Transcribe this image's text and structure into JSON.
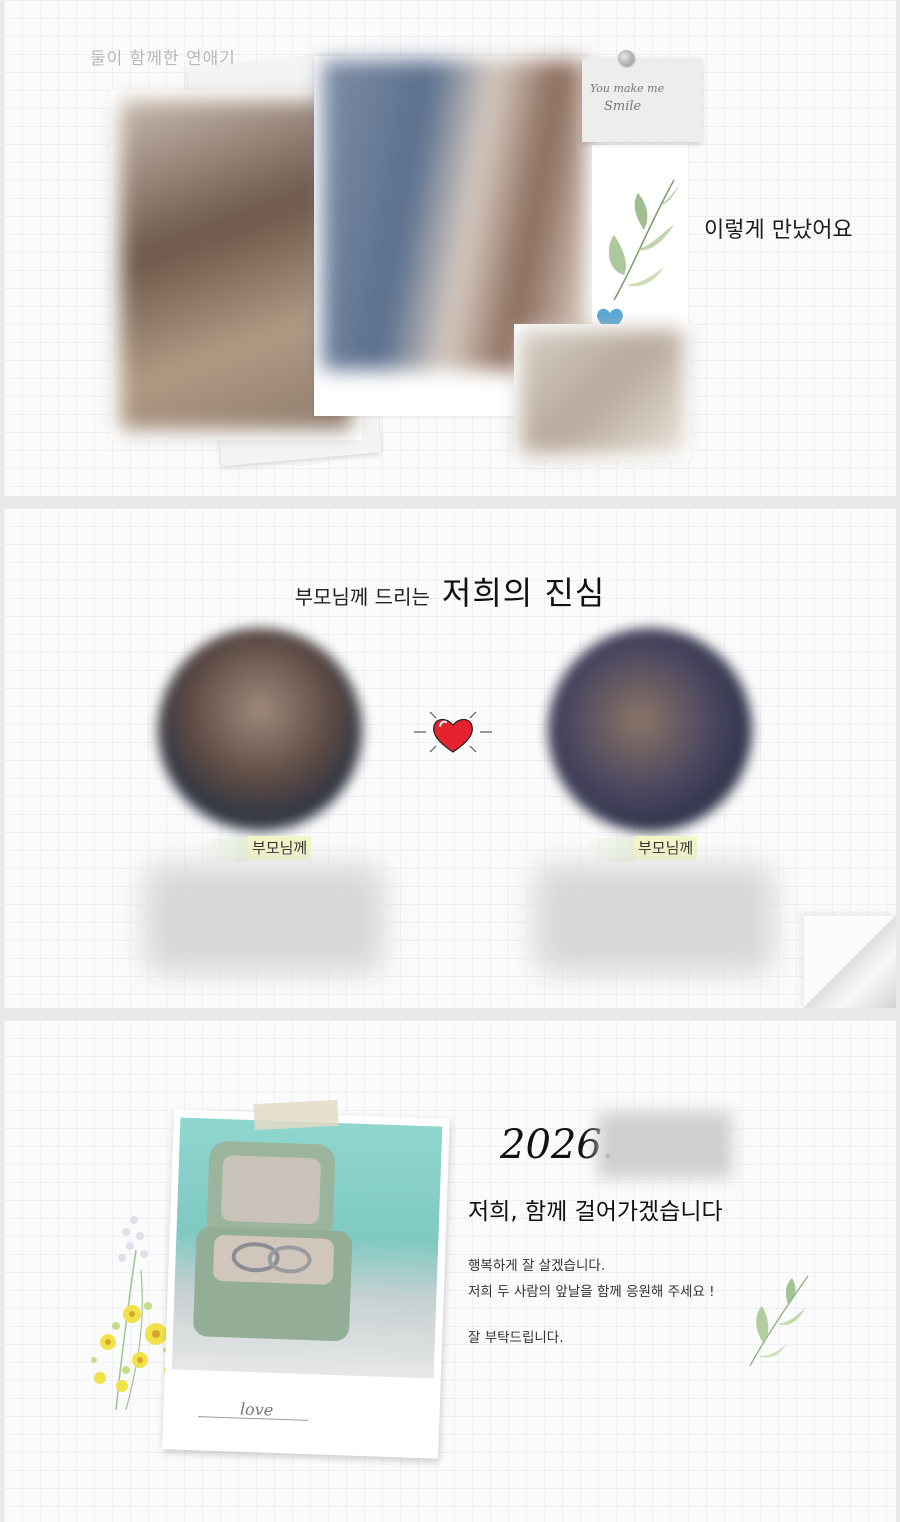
{
  "section1": {
    "title": "둘이 함께한 연애기",
    "note_line1": "You make me",
    "note_line2": "Smile",
    "heart_mark": "love",
    "met_text": "이렇게 만났어요"
  },
  "section2": {
    "title_small": "부모님께 드리는",
    "title_big": "저희의 진심",
    "left_label": "부모님께",
    "right_label": "부모님께"
  },
  "section3": {
    "date_prefix": "2026.",
    "headline": "저희, 함께 걸어가겠습니다",
    "line1": "행복하게 잘 살겠습니다.",
    "line2": "저희 두 사람의 앞날을 함께 응원해 주세요 !",
    "line3": "잘 부탁드립니다.",
    "photo_caption": "love"
  },
  "colors": {
    "background": "#fbfbfc",
    "grid": "#eef0f3",
    "label_highlight": "#f4f6c6",
    "heart_red": "#e5232e",
    "mint": "#8fd6cf"
  }
}
